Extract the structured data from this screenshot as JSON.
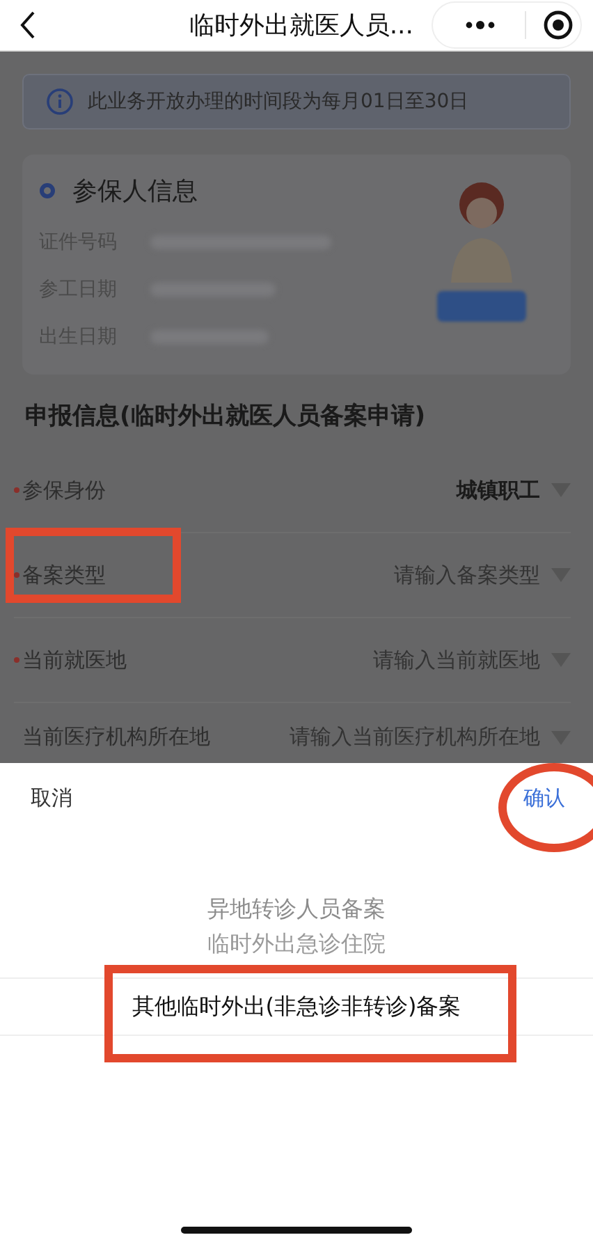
{
  "nav": {
    "title": "临时外出就医人员..."
  },
  "notice": {
    "text": "此业务开放办理的时间段为每月01日至30日"
  },
  "insured": {
    "title": "参保人信息",
    "fields": [
      {
        "label": "证件号码"
      },
      {
        "label": "参工日期"
      },
      {
        "label": "出生日期"
      }
    ]
  },
  "form": {
    "title": "申报信息(临时外出就医人员备案申请)",
    "rows": [
      {
        "label": "参保身份",
        "required": true,
        "value": "城镇职工",
        "highlighted": false
      },
      {
        "label": "备案类型",
        "required": true,
        "placeholder": "请输入备案类型",
        "highlighted": true
      },
      {
        "label": "当前就医地",
        "required": true,
        "placeholder": "请输入当前就医地",
        "highlighted": false
      },
      {
        "label": "当前医疗机构所在地",
        "required": false,
        "placeholder": "请输入当前医疗机构所在地",
        "highlighted": false
      }
    ]
  },
  "picker": {
    "cancel": "取消",
    "confirm": "确认",
    "confirm_circled": true,
    "options": [
      {
        "label": "异地转诊人员备案",
        "selected": false,
        "highlighted": false
      },
      {
        "label": "临时外出急诊住院",
        "selected": false,
        "highlighted": false
      },
      {
        "label": "其他临时外出(非急诊非转诊)备案",
        "selected": true,
        "highlighted": true
      }
    ]
  }
}
